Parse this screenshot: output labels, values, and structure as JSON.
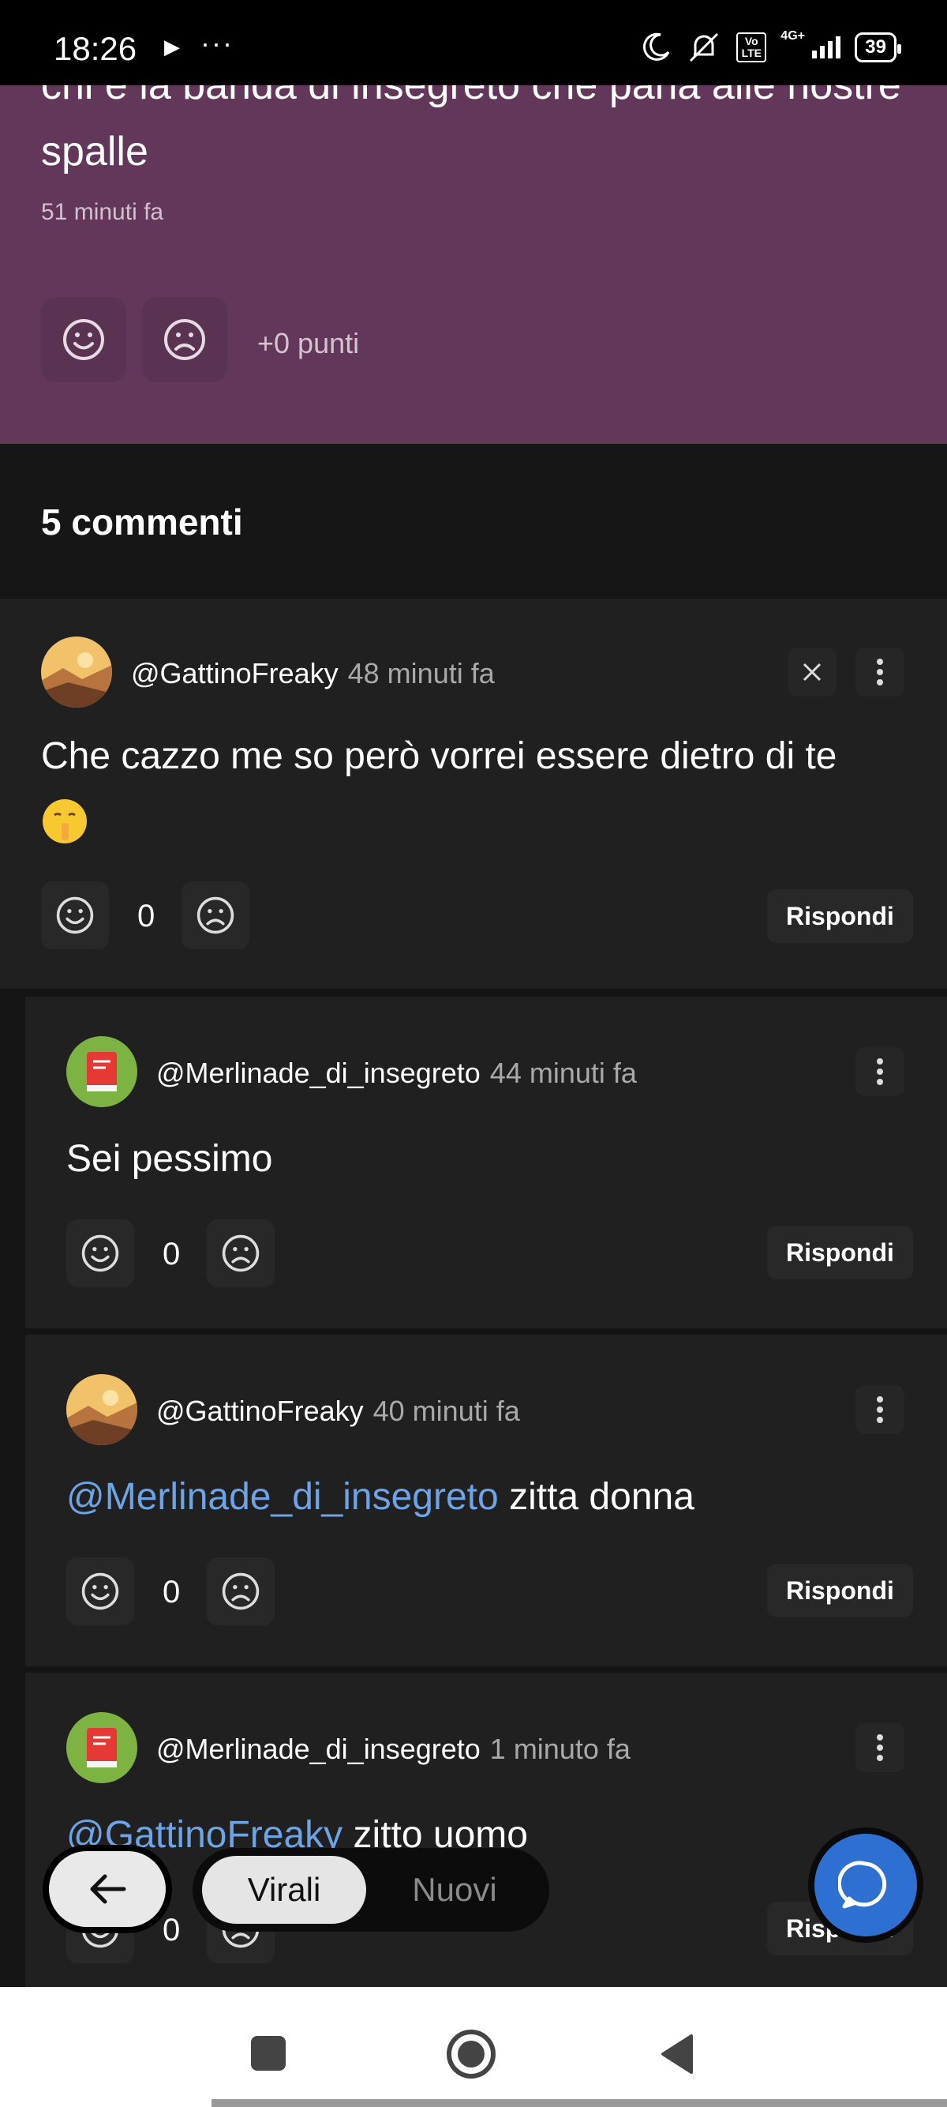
{
  "status_bar": {
    "time": "18:26",
    "play_icon": "▶",
    "more_icon": "···",
    "volte": "Vo LTE",
    "network": "4G+",
    "battery": "39"
  },
  "post": {
    "text": "chi è la banda di insegreto che parla alle nostre spalle",
    "time": "51 minuti fa",
    "points": "+0 punti",
    "background_color": "#62375a"
  },
  "comments_header": {
    "title": "5 commenti"
  },
  "comments": [
    {
      "username": "@GattinoFreaky",
      "time": "48 minuti fa",
      "mention": "",
      "text": "Che cazzo me so però vorrei essere dietro di te",
      "emoji": "shushing-face-emoji",
      "count": "0",
      "reply_label": "Rispondi",
      "avatar": "landscape-avatar"
    },
    {
      "username": "@Merlinade_di_insegreto",
      "time": "44 minuti fa",
      "mention": "",
      "text": "Sei pessimo",
      "count": "0",
      "reply_label": "Rispondi",
      "avatar": "red-book-avatar"
    },
    {
      "username": "@GattinoFreaky",
      "time": "40 minuti fa",
      "mention": "@Merlinade_di_insegreto",
      "text": "zitta donna",
      "count": "0",
      "reply_label": "Rispondi",
      "avatar": "landscape-avatar"
    },
    {
      "username": "@Merlinade_di_insegreto",
      "time": "1 minuto fa",
      "mention": "@GattinoFreaky",
      "text": "zitto uomo",
      "count": "0",
      "reply_label": "Rispondi",
      "avatar": "red-book-avatar"
    }
  ],
  "bottom_bar": {
    "tabs": [
      "Virali",
      "Nuovi"
    ],
    "selected_tab": "Virali",
    "chat_color": "#2e6fd2"
  }
}
